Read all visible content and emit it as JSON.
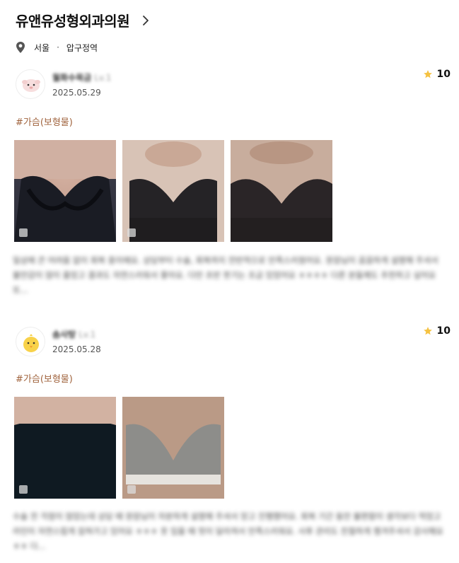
{
  "header": {
    "clinic_name": "유앤유성형외과의원",
    "location_city": "서울",
    "location_dot": "·",
    "location_station": "압구정역"
  },
  "reviews": [
    {
      "user_name": "월화수목금",
      "user_level": "Lv.1",
      "date": "2025.05.29",
      "rating": "10",
      "tag": "#가슴(보형물)",
      "photo_count": 3,
      "body": "일상에 큰 어려움 없이 회복 중이에요. 상담부터 수술, 회복까지 전반적으로 만족스러웠어요. 원장님이 꼼꼼하게 설명해 주셔서 불안감이 많이 줄었고 결과도 자연스러워서 좋아요. 다만 초반 붓기는 조금 있었어요 ㅎㅎㅎㅎ 다른 분들께도 추천하고 싶어요 또..."
    },
    {
      "user_name": "솜사탕",
      "user_level": "Lv.1",
      "date": "2025.05.28",
      "rating": "10",
      "tag": "#가슴(보형물)",
      "photo_count": 2,
      "body": "수술 전 걱정이 많았는데 상담 때 원장님이 차분하게 설명해 주셔서 믿고 진행했어요. 회복 기간 동안 불편함이 생각보다 적었고 라인이 자연스럽게 잡혀가고 있어요 ㅎㅎㅎ 옷 입을 때 핏이 달라져서 만족스러워요. 사후 관리도 친절하게 챙겨주셔서 감사해요 ㅎㅎ 다..."
    }
  ],
  "icons": {
    "chevron": "chevron-right-icon",
    "location": "location-pin-icon",
    "star": "star-icon"
  },
  "colors": {
    "tag": "#a0633d",
    "star": "#f5c242"
  }
}
